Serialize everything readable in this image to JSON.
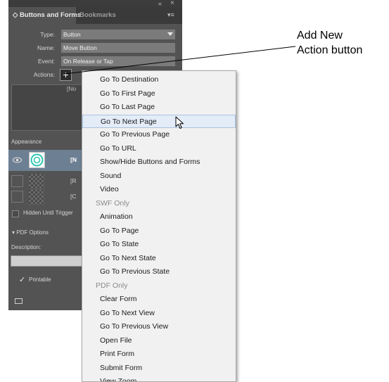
{
  "panel": {
    "collapse_icon": "«",
    "close_icon": "×",
    "tabs": [
      {
        "label": "◇ Buttons and Forms"
      },
      {
        "label": "Bookmarks"
      }
    ],
    "menu_icon": "▾≡",
    "fields": {
      "type": {
        "label": "Type:",
        "value": "Button"
      },
      "name": {
        "label": "Name:",
        "value": "Move Button"
      },
      "event": {
        "label": "Event:",
        "value": "On Release or Tap"
      },
      "actions": {
        "label": "Actions:",
        "add_label": "+"
      }
    },
    "actions_list_text": "[No",
    "appearance": {
      "title": "Appearance",
      "rows": [
        {
          "label": "[N"
        },
        {
          "label": "[R"
        },
        {
          "label": "[C"
        }
      ]
    },
    "hidden_until_triggered": "Hidden Until Trigger",
    "pdf_options": "PDF Options",
    "description_label": "Description:",
    "printable_check": "✓",
    "printable_label": "Printable"
  },
  "menu": {
    "items": [
      {
        "label": "Go To Destination",
        "kind": "item"
      },
      {
        "label": "Go To First Page",
        "kind": "item"
      },
      {
        "label": "Go To Last Page",
        "kind": "item"
      },
      {
        "label": "Go To Next Page",
        "kind": "highlighted"
      },
      {
        "label": "Go To Previous Page",
        "kind": "item"
      },
      {
        "label": "Go To URL",
        "kind": "item"
      },
      {
        "label": "Show/Hide Buttons and Forms",
        "kind": "item"
      },
      {
        "label": "Sound",
        "kind": "item"
      },
      {
        "label": "Video",
        "kind": "item"
      },
      {
        "label": "SWF Only",
        "kind": "header"
      },
      {
        "label": "Animation",
        "kind": "item"
      },
      {
        "label": "Go To Page",
        "kind": "item"
      },
      {
        "label": "Go To State",
        "kind": "item"
      },
      {
        "label": "Go To Next State",
        "kind": "item"
      },
      {
        "label": "Go To Previous State",
        "kind": "item"
      },
      {
        "label": "PDF Only",
        "kind": "header"
      },
      {
        "label": "Clear Form",
        "kind": "item"
      },
      {
        "label": "Go To Next View",
        "kind": "item"
      },
      {
        "label": "Go To Previous View",
        "kind": "item"
      },
      {
        "label": "Open File",
        "kind": "item"
      },
      {
        "label": "Print Form",
        "kind": "item"
      },
      {
        "label": "Submit Form",
        "kind": "item"
      },
      {
        "label": "View Zoom",
        "kind": "item"
      }
    ]
  },
  "callout": {
    "line1": "Add New",
    "line2": "Action button"
  },
  "colors": {
    "panel_bg": "#535353",
    "menu_bg": "#f1f1f1",
    "highlight_bg": "#e3ecf7",
    "appearance_selected": "#6d7f93",
    "sel_icon": "#2ec7b5"
  }
}
